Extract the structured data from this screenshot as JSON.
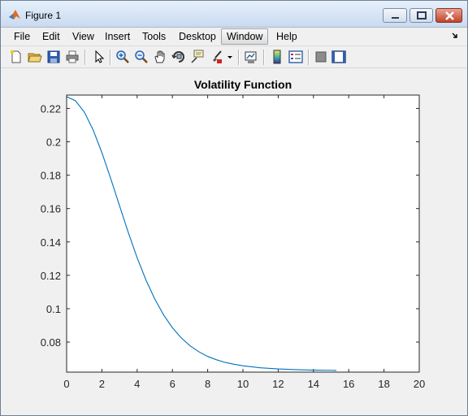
{
  "window": {
    "title": "Figure 1"
  },
  "menu": [
    {
      "label": "File"
    },
    {
      "label": "Edit"
    },
    {
      "label": "View"
    },
    {
      "label": "Insert"
    },
    {
      "label": "Tools"
    },
    {
      "label": "Desktop"
    },
    {
      "label": "Window"
    },
    {
      "label": "Help"
    }
  ],
  "toolbar_icons": [
    "new-figure-icon",
    "open-file-icon",
    "save-icon",
    "print-icon",
    "edit-plot-arrow-icon",
    "zoom-in-icon",
    "zoom-out-icon",
    "pan-hand-icon",
    "rotate-3d-icon",
    "data-cursor-icon",
    "brush-icon",
    "brush-dropdown-icon",
    "link-plot-icon",
    "colorbar-icon",
    "legend-icon",
    "hide-plot-tools-icon",
    "show-plot-tools-icon"
  ],
  "colors": {
    "line": "#0072bd",
    "accent": "#c0442b"
  },
  "chart_data": {
    "type": "line",
    "title": "Volatility Function",
    "xlabel": "",
    "ylabel": "",
    "xlim": [
      0,
      20
    ],
    "ylim": [
      0.062,
      0.228
    ],
    "xticks": [
      0,
      2,
      4,
      6,
      8,
      10,
      12,
      14,
      16,
      18,
      20
    ],
    "yticks": [
      0.08,
      0.1,
      0.12,
      0.14,
      0.16,
      0.18,
      0.2,
      0.22
    ],
    "ytick_labels": [
      "0.08",
      "0.1",
      "0.12",
      "0.14",
      "0.16",
      "0.18",
      "0.2",
      "0.22"
    ],
    "grid": false,
    "series": [
      {
        "x": [
          0,
          0.5,
          1,
          1.5,
          2,
          2.5,
          3,
          3.5,
          4,
          4.5,
          5,
          5.5,
          6,
          6.5,
          7,
          7.5,
          8,
          8.5,
          9,
          9.5,
          10,
          11,
          12,
          13,
          14,
          15,
          15.3
        ],
        "y": [
          0.227,
          0.2246,
          0.2179,
          0.2072,
          0.1935,
          0.178,
          0.1617,
          0.1456,
          0.1305,
          0.1172,
          0.1058,
          0.0963,
          0.0886,
          0.0825,
          0.0778,
          0.0742,
          0.0714,
          0.0694,
          0.0678,
          0.0667,
          0.0658,
          0.0646,
          0.0639,
          0.0635,
          0.0632,
          0.0631,
          0.063
        ]
      }
    ]
  }
}
